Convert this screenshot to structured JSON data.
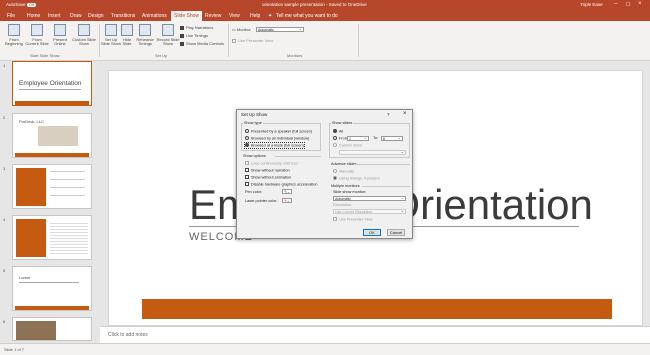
{
  "titlebar": {
    "autosave": "AutoSave",
    "toggle": "Off",
    "document": "orientation sample presentation - Saved to OneDrive",
    "user": "Triple Ease"
  },
  "tabs": [
    "File",
    "Home",
    "Insert",
    "Draw",
    "Design",
    "Transitions",
    "Animations",
    "Slide Show",
    "Review",
    "View",
    "Help"
  ],
  "tellme": "Tell me what you want to do",
  "ribbon": {
    "start_buttons": [
      "From\nBeginning",
      "From\nCurrent Slide",
      "Present\nOnline",
      "Custom Slide\nShow"
    ],
    "setup_buttons": [
      "Set Up\nSlide Show",
      "Hide\nSlide",
      "Rehearse\nTimings",
      "Record Slide\nShow"
    ],
    "checks": [
      "Play Narrations",
      "Use Timings",
      "Show Media Controls"
    ],
    "monitor_label": "Monitor:",
    "monitor_value": "Automatic",
    "presenter_view": "Use Presenter View",
    "groups": [
      "Start Slide Show",
      "Set Up",
      "Monitors"
    ]
  },
  "thumbnails": {
    "slide1_title": "Employee Orientation",
    "slide2_title": "PurDeck, LLC",
    "slide4_text": "Lorem"
  },
  "slide": {
    "title": "Employee Orientation",
    "subtitle": "WELCOME"
  },
  "notes_placeholder": "Click to add notes",
  "status": "Slide 1 of 7",
  "dialog": {
    "title": "Set Up Show",
    "help": "?",
    "close": "×",
    "show_type": {
      "heading": "Show type",
      "options": [
        "Presented by a speaker (full screen)",
        "Browsed by an individual (window)",
        "Browsed at a kiosk (full screen)"
      ]
    },
    "show_options": {
      "heading": "Show options",
      "items": [
        "Loop continuously until 'Esc'",
        "Show without narration",
        "Show without animation",
        "Disable hardware graphics acceleration"
      ],
      "pen_color": "Pen color:",
      "laser_color": "Laser pointer color:"
    },
    "show_slides": {
      "heading": "Show slides",
      "all": "All",
      "from": "From:",
      "from_value": "1",
      "to": "To:",
      "to_value": "6",
      "custom": "Custom show:"
    },
    "advance": {
      "heading": "Advance slides",
      "manually": "Manually",
      "timings": "Using timings, if present"
    },
    "monitors": {
      "heading": "Multiple monitors",
      "slide_monitor_label": "Slide show monitor:",
      "slide_monitor_value": "Automatic",
      "resolution_label": "Resolution:",
      "resolution_value": "Use Current Resolution",
      "presenter_view": "Use Presenter View"
    },
    "ok": "OK",
    "cancel": "Cancel"
  },
  "colors": {
    "accent": "#b7472a",
    "slide_band": "#c55a11"
  }
}
